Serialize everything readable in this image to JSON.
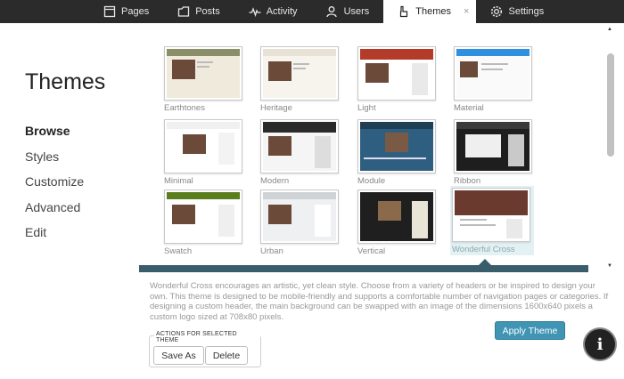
{
  "nav": {
    "tabs": [
      {
        "label": "Pages",
        "icon": "pages-icon"
      },
      {
        "label": "Posts",
        "icon": "posts-icon"
      },
      {
        "label": "Activity",
        "icon": "activity-icon"
      },
      {
        "label": "Users",
        "icon": "users-icon"
      },
      {
        "label": "Themes",
        "icon": "themes-icon",
        "active": true
      },
      {
        "label": "Settings",
        "icon": "gear-icon"
      }
    ],
    "close_glyph": "×"
  },
  "page": {
    "title": "Themes",
    "sidebar": {
      "items": [
        {
          "label": "Browse",
          "active": true
        },
        {
          "label": "Styles"
        },
        {
          "label": "Customize"
        },
        {
          "label": "Advanced"
        },
        {
          "label": "Edit"
        }
      ]
    }
  },
  "themes": [
    {
      "name": "Earthtones",
      "accent": "#8a8f6a"
    },
    {
      "name": "Heritage",
      "accent": "#e8e2d6"
    },
    {
      "name": "Light",
      "accent": "#b43a2a"
    },
    {
      "name": "Material",
      "accent": "#2f8fe0"
    },
    {
      "name": "Minimal",
      "accent": "#f0f0f0"
    },
    {
      "name": "Modern",
      "accent": "#2a2a2a"
    },
    {
      "name": "Module",
      "accent": "#2f5f80"
    },
    {
      "name": "Ribbon",
      "accent": "#1e1e1e"
    },
    {
      "name": "Swatch",
      "accent": "#5a7d1e"
    },
    {
      "name": "Urban",
      "accent": "#cfd3d6"
    },
    {
      "name": "Vertical",
      "accent": "#1f1f1f"
    },
    {
      "name": "Wonderful Cross",
      "accent": "#6b3a2e",
      "selected": true
    }
  ],
  "description": "Wonderful Cross encourages an artistic, yet clean style. Choose from a variety of headers or be inspired to design your own. This theme is designed to be mobile-friendly and supports a comfortable number of navigation pages or categories. If designing a custom header, the main background can be swapped with an image of the dimensions 1600x640 pixels a custom logo sized at 708x80 pixels.",
  "actions": {
    "legend": "ACTIONS FOR SELECTED THEME",
    "save_as": "Save As",
    "delete": "Delete",
    "apply": "Apply Theme"
  },
  "help": {
    "glyph": "i"
  },
  "colors": {
    "apply_button": "#3f95b3",
    "sep_bar": "#3a5d6b",
    "topbar": "#2b2b2b"
  }
}
